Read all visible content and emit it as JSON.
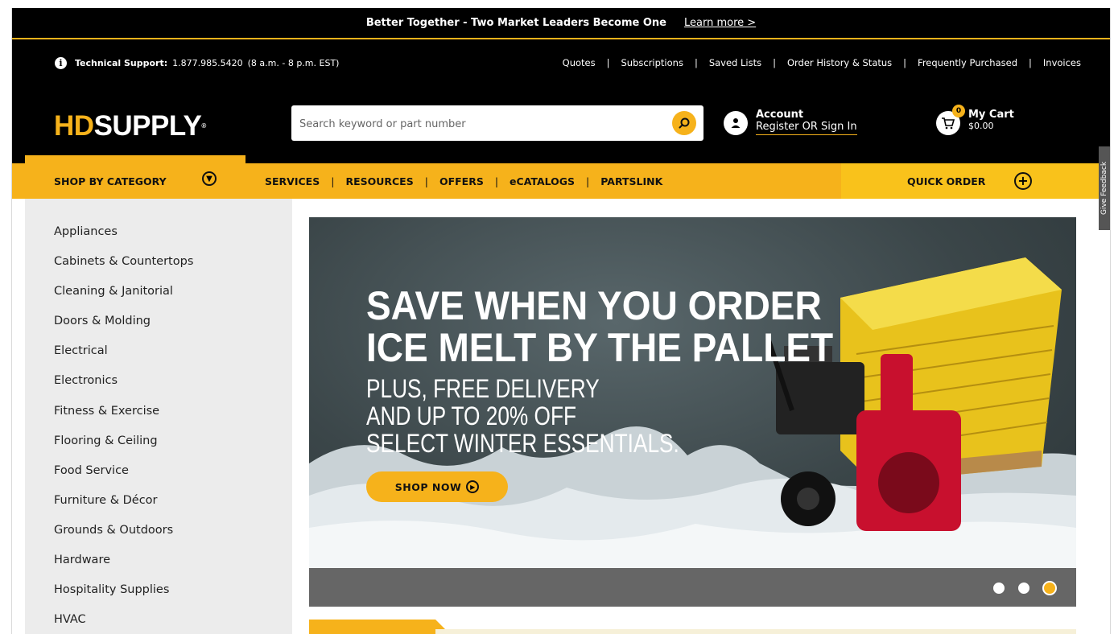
{
  "announcement": {
    "message": "Better Together - Two Market Leaders Become One",
    "link": "Learn more >"
  },
  "support": {
    "label": "Technical Support:",
    "phone": "1.877.985.5420",
    "hours": "(8 a.m. - 8 p.m. EST)"
  },
  "top_links": [
    "Quotes",
    "Subscriptions",
    "Saved Lists",
    "Order History & Status",
    "Frequently Purchased",
    "Invoices"
  ],
  "logo": {
    "hd": "HD",
    "supply": "SUPPLY",
    "tm": "®"
  },
  "search": {
    "placeholder": "Search keyword or part number",
    "value": ""
  },
  "account": {
    "title": "Account",
    "link": "Register OR Sign In"
  },
  "cart": {
    "title": "My Cart",
    "total": "$0.00",
    "count": "0"
  },
  "nav": {
    "shop_by_category": "SHOP BY CATEGORY",
    "links": [
      "SERVICES",
      "RESOURCES",
      "OFFERS",
      "eCATALOGS",
      "PARTSLINK"
    ],
    "quick_order": "QUICK ORDER"
  },
  "feedback": "Give Feedback",
  "categories": [
    "Appliances",
    "Cabinets & Countertops",
    "Cleaning & Janitorial",
    "Doors & Molding",
    "Electrical",
    "Electronics",
    "Fitness & Exercise",
    "Flooring & Ceiling",
    "Food Service",
    "Furniture & Décor",
    "Grounds & Outdoors",
    "Hardware",
    "Hospitality Supplies",
    "HVAC"
  ],
  "hero": {
    "headline_1": "SAVE WHEN YOU ORDER",
    "headline_2": "ICE MELT BY THE PALLET",
    "sub_1": "PLUS, FREE DELIVERY",
    "sub_2": "AND UP TO 20% OFF",
    "sub_3": "SELECT WINTER ESSENTIALS.",
    "cta": "SHOP NOW"
  },
  "carousel": {
    "slides": 3,
    "active_index": 2
  },
  "colors": {
    "brand_yellow": "#f6b21b",
    "black": "#000000",
    "sidebar_bg": "#ececec"
  }
}
